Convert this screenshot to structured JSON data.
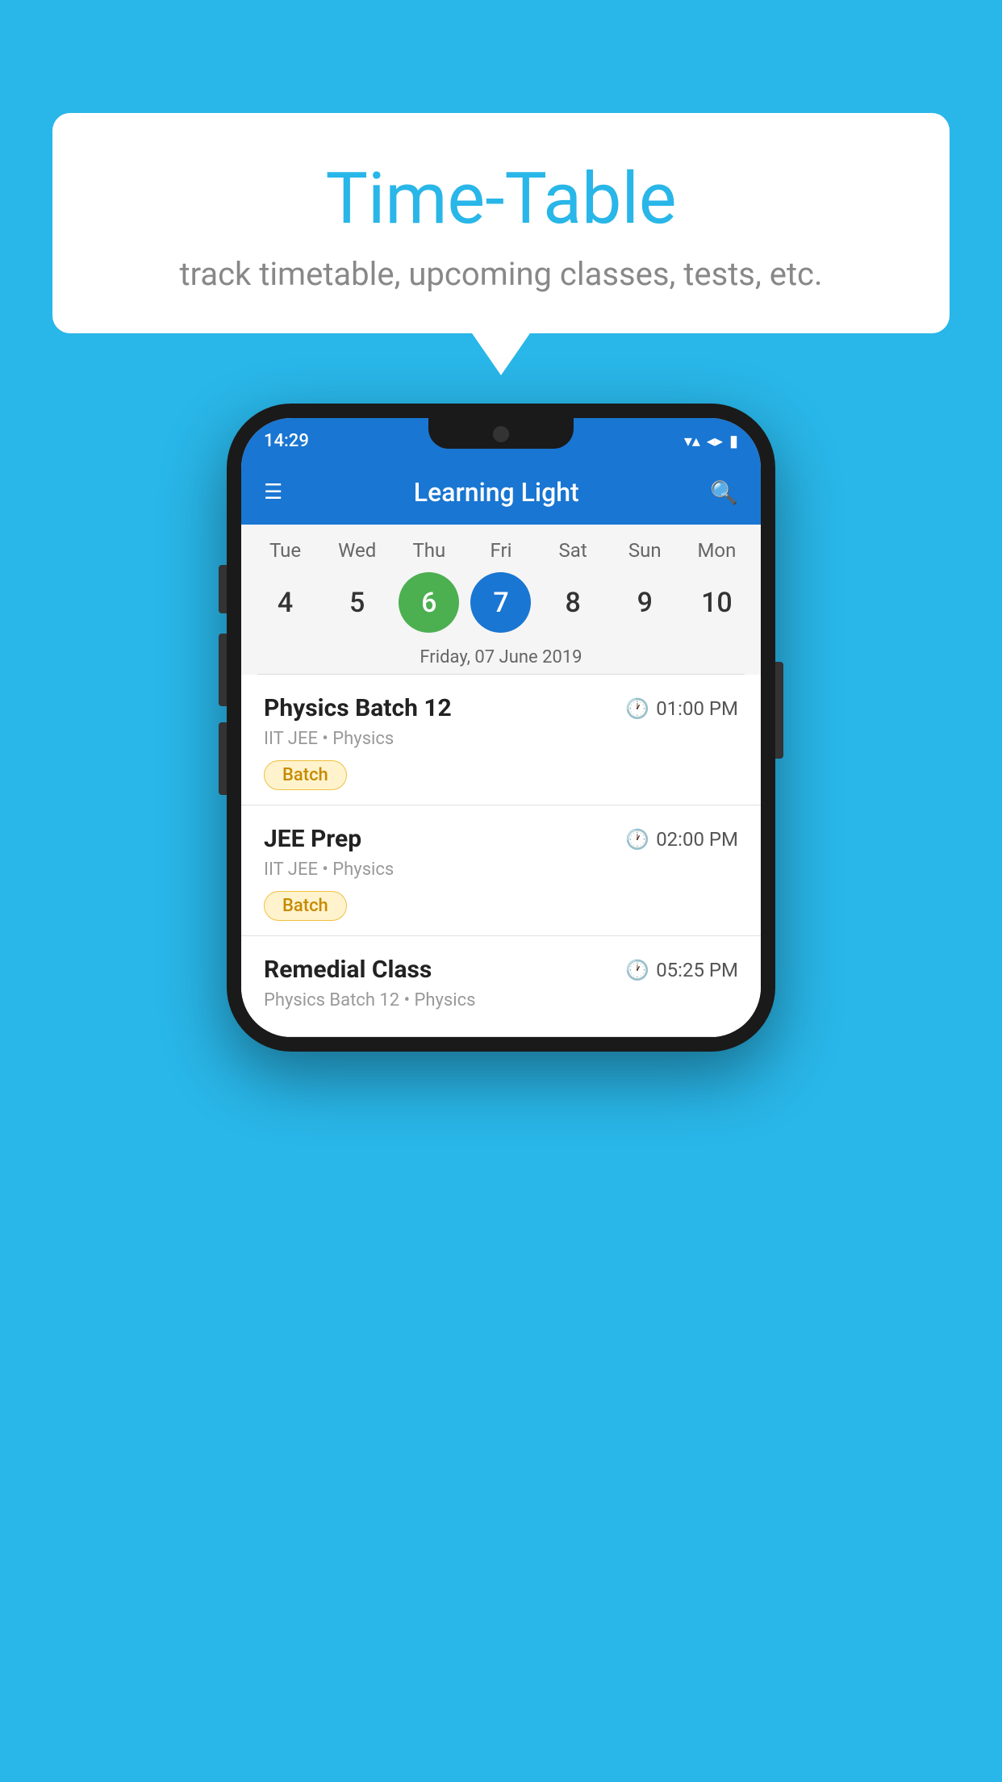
{
  "background_color": "#29b6e8",
  "speech_bubble": {
    "title": "Time-Table",
    "subtitle": "track timetable, upcoming classes, tests, etc."
  },
  "phone": {
    "status_bar": {
      "time": "14:29",
      "wifi": "▼",
      "signal": "◀",
      "battery": "▮"
    },
    "app_bar": {
      "title": "Learning Light",
      "menu_icon": "☰",
      "search_icon": "⌕"
    },
    "calendar": {
      "days": [
        "Tue",
        "Wed",
        "Thu",
        "Fri",
        "Sat",
        "Sun",
        "Mon"
      ],
      "dates": [
        "4",
        "5",
        "6",
        "7",
        "8",
        "9",
        "10"
      ],
      "today_index": 2,
      "selected_index": 3,
      "selected_label": "Friday, 07 June 2019"
    },
    "classes": [
      {
        "name": "Physics Batch 12",
        "time": "01:00 PM",
        "meta": "IIT JEE • Physics",
        "tag": "Batch"
      },
      {
        "name": "JEE Prep",
        "time": "02:00 PM",
        "meta": "IIT JEE • Physics",
        "tag": "Batch"
      },
      {
        "name": "Remedial Class",
        "time": "05:25 PM",
        "meta": "Physics Batch 12 • Physics",
        "tag": ""
      }
    ]
  }
}
